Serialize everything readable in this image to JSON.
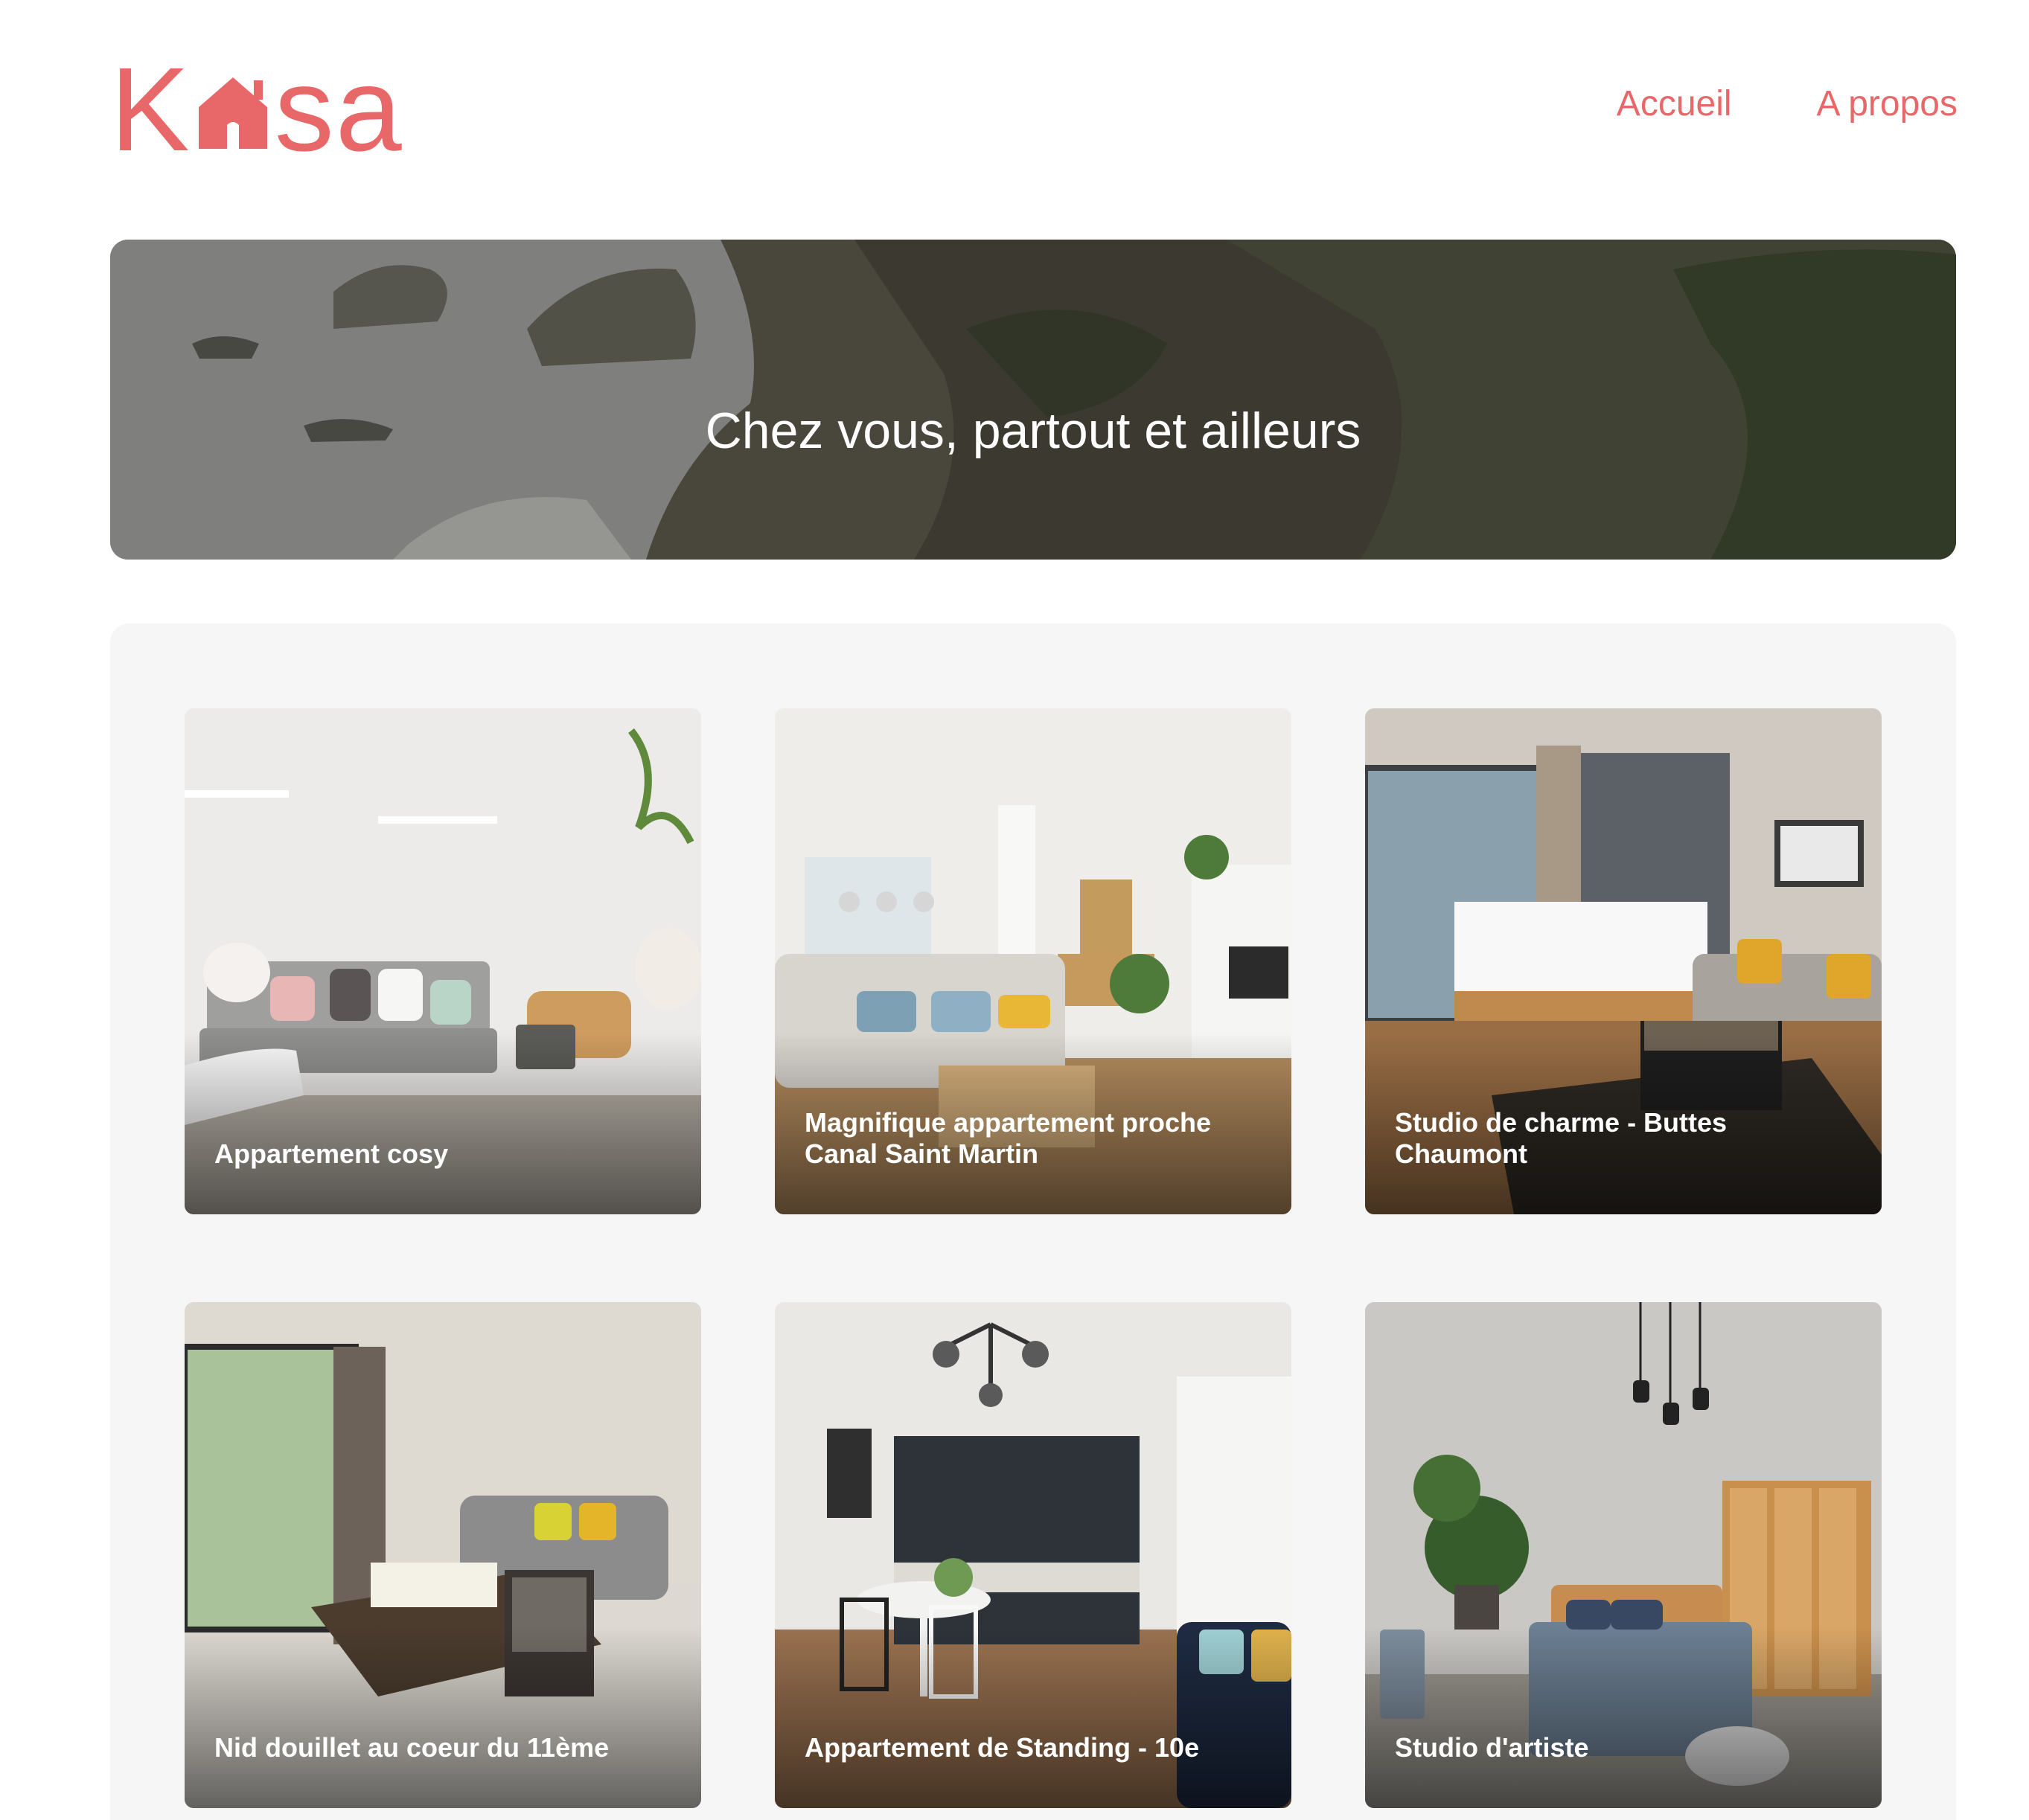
{
  "brand": {
    "logo_left": "K",
    "logo_right": "sa",
    "color": "#E8686A"
  },
  "nav": {
    "home_label": "Accueil",
    "about_label": "A propos"
  },
  "banner": {
    "title": "Chez vous, partout et ailleurs"
  },
  "listings": [
    {
      "title": "Appartement cosy"
    },
    {
      "title": "Magnifique appartement proche Canal Saint Martin"
    },
    {
      "title": "Studio de charme - Buttes Chaumont"
    },
    {
      "title": "Nid douillet au coeur du 11ème"
    },
    {
      "title": "Appartement de Standing - 10e"
    },
    {
      "title": "Studio d'artiste"
    }
  ],
  "colors": {
    "accent": "#E8686A",
    "gallery_background": "#F6F6F6",
    "card_text": "#FFFFFF"
  }
}
